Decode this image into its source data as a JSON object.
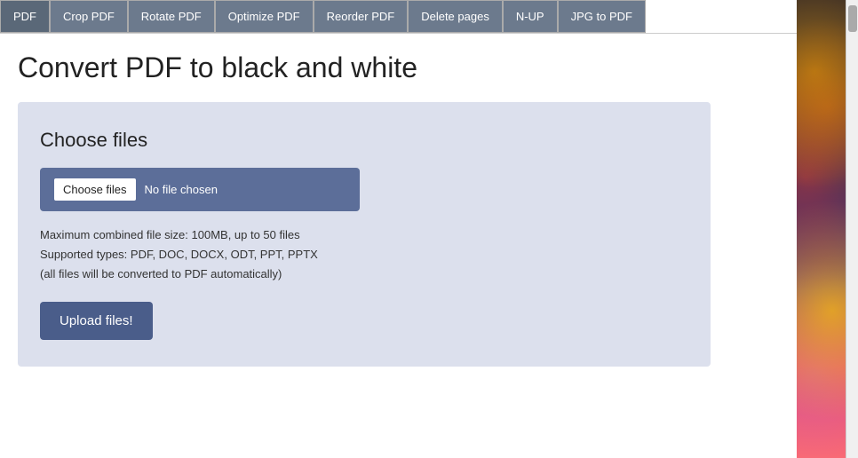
{
  "nav": {
    "items": [
      {
        "label": "PDF",
        "id": "pdf"
      },
      {
        "label": "Crop PDF",
        "id": "crop-pdf"
      },
      {
        "label": "Rotate PDF",
        "id": "rotate-pdf"
      },
      {
        "label": "Optimize PDF",
        "id": "optimize-pdf"
      },
      {
        "label": "Reorder PDF",
        "id": "reorder-pdf"
      },
      {
        "label": "Delete pages",
        "id": "delete-pages"
      },
      {
        "label": "N-UP",
        "id": "n-up"
      },
      {
        "label": "JPG to PDF",
        "id": "jpg-to-pdf"
      }
    ]
  },
  "page": {
    "title": "Convert PDF to black and white"
  },
  "upload": {
    "section_title": "Choose files",
    "choose_btn_label": "Choose files",
    "no_file_text": "No file chosen",
    "info_line1": "Maximum combined file size: 100MB, up to 50 files",
    "info_line2": "Supported types: PDF, DOC, DOCX, ODT, PPT, PPTX",
    "info_line3": "(all files will be converted to PDF automatically)",
    "upload_btn_label": "Upload files!"
  }
}
